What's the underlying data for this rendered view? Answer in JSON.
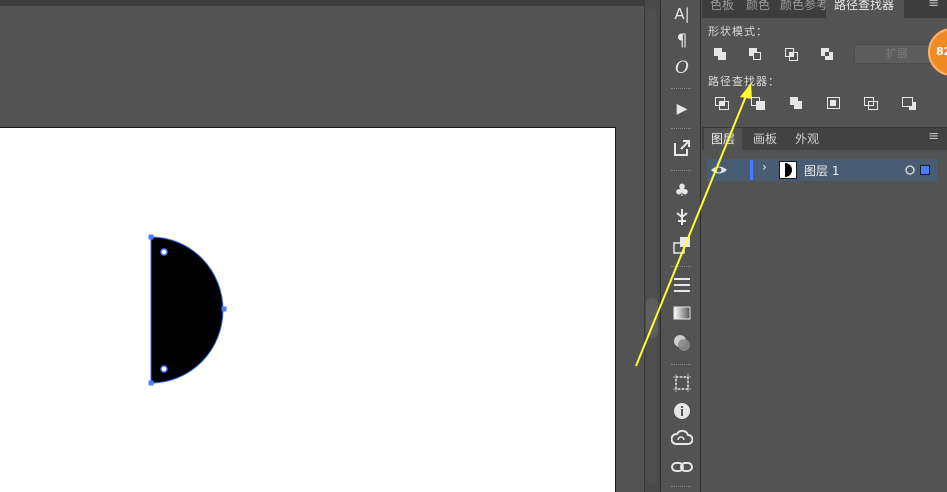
{
  "pathfinder_panel": {
    "tabs": [
      "色板",
      "颜色",
      "颜色参考",
      "路径查找器"
    ],
    "active_tab": "路径查找器",
    "shape_modes_label": "形状模式：",
    "pathfinders_label": "路径查找器：",
    "expand_label": "扩展",
    "shape_mode_icons": [
      "unite-icon",
      "minus-front-icon",
      "intersect-icon",
      "exclude-icon"
    ],
    "pathfinder_icons": [
      "divide-icon",
      "trim-icon",
      "merge-icon",
      "crop-icon",
      "outline-icon",
      "minus-back-icon"
    ]
  },
  "badge": {
    "text": "82"
  },
  "layers_panel": {
    "tabs": [
      "图层",
      "画板",
      "外观"
    ],
    "active_tab": "图层",
    "layer_name": "图层 1"
  },
  "tools": {
    "type_glyph": "A|",
    "paragraph_glyph": "¶",
    "opentype_glyph": "O",
    "play_glyph": "▶",
    "club_glyph": "♣",
    "info_glyph": "i"
  },
  "colors": {
    "accent": "#4a7cff",
    "annotation_arrow": "#ffff33",
    "badge": "#f08a24",
    "layer_selected": "#485c73"
  }
}
